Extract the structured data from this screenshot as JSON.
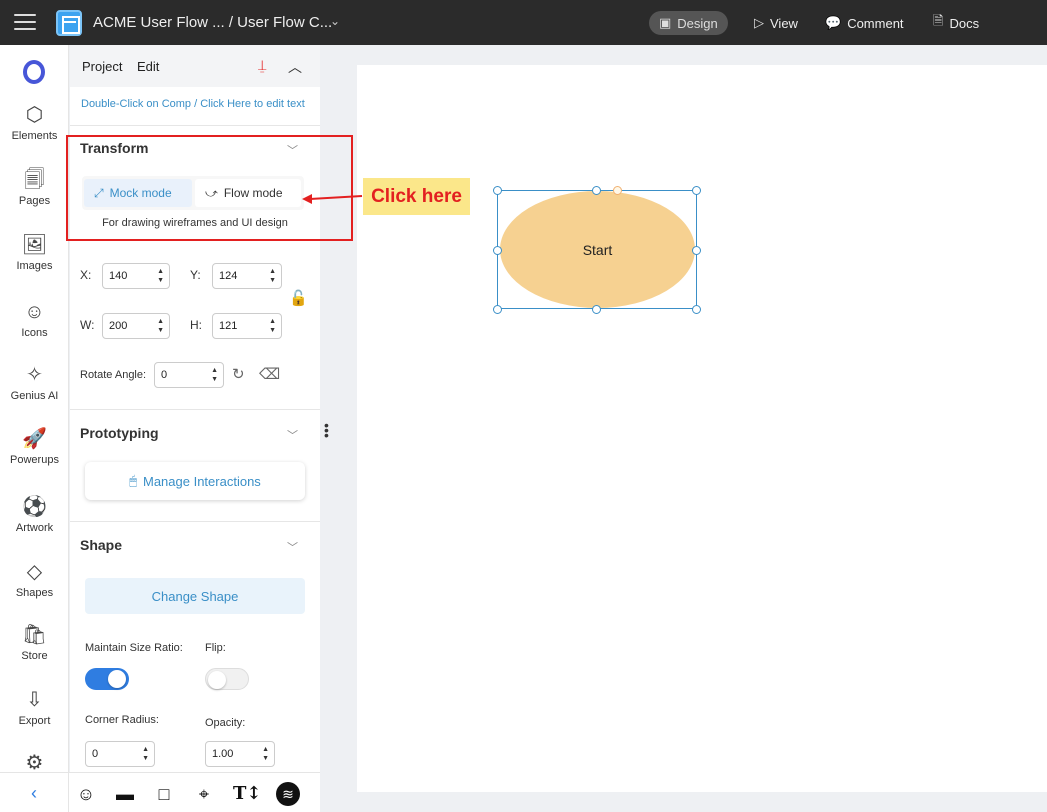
{
  "topbar": {
    "doc_title": "ACME User Flow ... / User Flow C...",
    "tabs": [
      {
        "label": "Design",
        "icon": "layout-icon",
        "glyph": "▣"
      },
      {
        "label": "View",
        "icon": "play-icon",
        "glyph": "▷"
      },
      {
        "label": "Comment",
        "icon": "comment-icon",
        "glyph": "💬"
      },
      {
        "label": "Docs",
        "icon": "document-icon",
        "glyph": "🗎"
      }
    ]
  },
  "sidebar": {
    "items": [
      {
        "label": "Elements",
        "glyph": "⬡"
      },
      {
        "label": "Pages",
        "glyph": "🗐"
      },
      {
        "label": "Images",
        "glyph": "🖼"
      },
      {
        "label": "Icons",
        "glyph": "☺"
      },
      {
        "label": "Genius AI",
        "glyph": "✧"
      },
      {
        "label": "Powerups",
        "glyph": "🚀"
      },
      {
        "label": "Artwork",
        "glyph": "⚽"
      },
      {
        "label": "Shapes",
        "glyph": "◇"
      },
      {
        "label": "Store",
        "glyph": "🛍"
      },
      {
        "label": "Export",
        "glyph": "⇩"
      }
    ]
  },
  "panel": {
    "tabs": [
      "Project",
      "Edit"
    ],
    "hint": "Double-Click on Comp / Click Here to edit text",
    "transform": {
      "title": "Transform",
      "modes": [
        {
          "label": "Mock mode",
          "glyph": "⤢",
          "active": true
        },
        {
          "label": "Flow mode",
          "glyph": "⤻",
          "active": false
        }
      ],
      "description": "For drawing wireframes and UI design",
      "x_label": "X:",
      "x_value": "140",
      "y_label": "Y:",
      "y_value": "124",
      "w_label": "W:",
      "w_value": "200",
      "h_label": "H:",
      "h_value": "121",
      "rotate_label": "Rotate Angle:",
      "rotate_value": "0"
    },
    "prototyping": {
      "title": "Prototyping",
      "button": "Manage Interactions"
    },
    "shape": {
      "title": "Shape",
      "change_button": "Change Shape",
      "maintain_ratio_label": "Maintain Size Ratio:",
      "maintain_ratio_on": true,
      "flip_label": "Flip:",
      "flip_on": false,
      "corner_radius_label": "Corner Radius:",
      "corner_radius_value": "0",
      "opacity_label": "Opacity:",
      "opacity_value": "1.00"
    }
  },
  "annotation": {
    "callout": "Click here",
    "color": "#e32020"
  },
  "canvas": {
    "shape_label": "Start",
    "shape_fill": "#f6d191",
    "selection_color": "#3a8fc7"
  },
  "colors": {
    "accent": "#3a8fc7",
    "topbar": "#2b2b2b",
    "toggle_on": "#2f7de1"
  }
}
